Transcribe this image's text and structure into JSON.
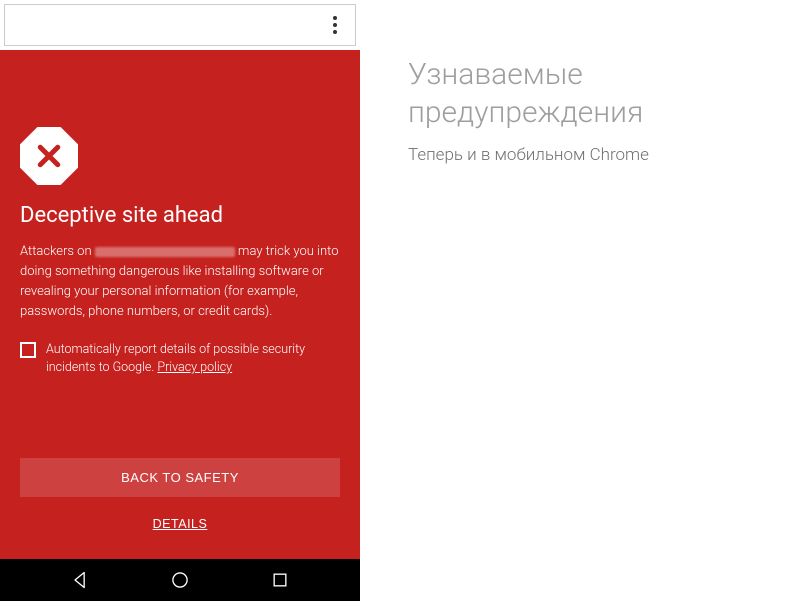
{
  "urlbar": {
    "placeholder": ""
  },
  "warning": {
    "title": "Deceptive site ahead",
    "body_prefix": "Attackers on ",
    "body_suffix": " may trick you into doing something dangerous like installing software or revealing your personal information (for example, passwords, phone numbers, or credit cards).",
    "checkbox_label_prefix": "Automatically report details of possible security incidents to Google. ",
    "privacy_link": "Privacy policy",
    "back_button": "BACK TO SAFETY",
    "details_button": "DETAILS"
  },
  "panel": {
    "title": "Узнаваемые предупреждения",
    "subtitle": "Теперь и в мобильном Chrome"
  },
  "colors": {
    "warning_bg": "#c5221f"
  }
}
